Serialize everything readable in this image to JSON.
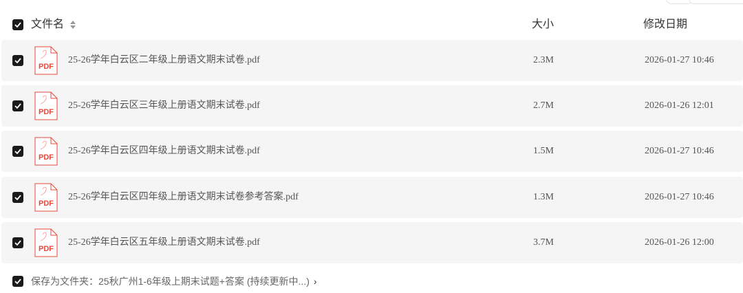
{
  "header": {
    "name_label": "文件名",
    "size_label": "大小",
    "date_label": "修改日期"
  },
  "files": [
    {
      "name": "25-26学年白云区二年级上册语文期末试卷.pdf",
      "size": "2.3M",
      "date": "2026-01-27 10:46",
      "icon": "pdf-file-icon",
      "icon_text": "PDF",
      "checked": true
    },
    {
      "name": "25-26学年白云区三年级上册语文期末试卷.pdf",
      "size": "2.7M",
      "date": "2026-01-26 12:01",
      "icon": "pdf-file-icon",
      "icon_text": "PDF",
      "checked": true
    },
    {
      "name": "25-26学年白云区四年级上册语文期末试卷.pdf",
      "size": "1.5M",
      "date": "2026-01-27 10:46",
      "icon": "pdf-file-icon",
      "icon_text": "PDF",
      "checked": true
    },
    {
      "name": "25-26学年白云区四年级上册语文期末试卷参考答案.pdf",
      "size": "1.3M",
      "date": "2026-01-27 10:46",
      "icon": "pdf-file-icon",
      "icon_text": "PDF",
      "checked": true
    },
    {
      "name": "25-26学年白云区五年级上册语文期末试卷.pdf",
      "size": "3.7M",
      "date": "2026-01-26 12:00",
      "icon": "pdf-file-icon",
      "icon_text": "PDF",
      "checked": true
    }
  ],
  "footer": {
    "save_text": "保存为文件夹：25秋广州1-6年级上期末试题+答案 (持续更新中...)",
    "chevron": "›",
    "checked": true
  },
  "colors": {
    "checkbox": "#1a1a1a",
    "row_bg": "#f5f5f5",
    "pdf_red": "#e5483b"
  }
}
